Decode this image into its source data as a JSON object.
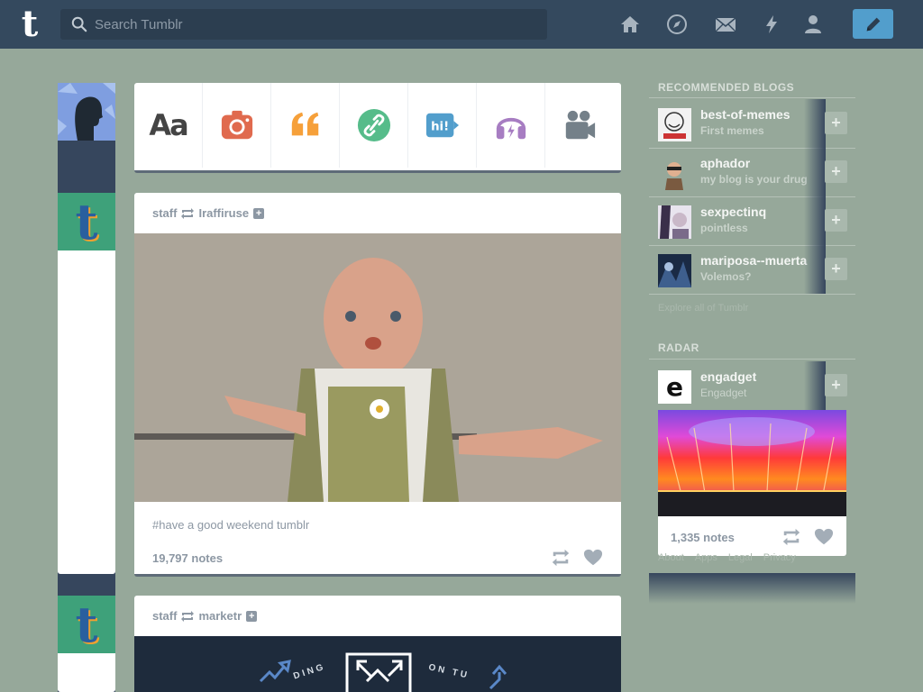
{
  "header": {
    "logo": "t",
    "search_placeholder": "Search Tumblr",
    "icons": [
      "home-icon",
      "explore-compass-icon",
      "inbox-mail-icon",
      "activity-lightning-icon",
      "account-person-icon"
    ],
    "compose_icon": "pencil-icon"
  },
  "post_types": {
    "text_glyph": "Aa",
    "items": [
      "text",
      "photo",
      "quote",
      "link",
      "chat",
      "audio",
      "video"
    ],
    "chat_glyph": "hi!",
    "colors": {
      "photo": "#e06a4e",
      "quote": "#f6a03a",
      "link": "#56bc8a",
      "chat": "#529ecc",
      "audio": "#a77dc2",
      "video": "#748089"
    }
  },
  "posts": [
    {
      "author": "staff",
      "reblogged_from": "Iraffiruse",
      "tags": "#have a good weekend tumblr",
      "notes": "19,797 notes"
    },
    {
      "author": "staff",
      "reblogged_from": "marketr",
      "banner_text_left": "DING",
      "banner_text_right": "ON TU"
    }
  ],
  "sidebar": {
    "recommended_title": "RECOMMENDED BLOGS",
    "recommended": [
      {
        "name": "best-of-memes",
        "sub": "First memes"
      },
      {
        "name": "aphador",
        "sub": "my blog is your drug"
      },
      {
        "name": "sexpectinq",
        "sub": "pointless"
      },
      {
        "name": "mariposa--muerta",
        "sub": "Volemos?"
      }
    ],
    "explore_link": "Explore all of Tumblr",
    "radar_title": "RADAR",
    "radar": {
      "name": "engadget",
      "sub": "Engadget",
      "thumb_letter": "e",
      "notes": "1,335 notes"
    },
    "footer_links": [
      "About",
      "Apps",
      "Legal",
      "Privacy"
    ]
  },
  "colors": {
    "navy": "#34495e",
    "background": "#96a89a",
    "accent": "#529ecc"
  }
}
